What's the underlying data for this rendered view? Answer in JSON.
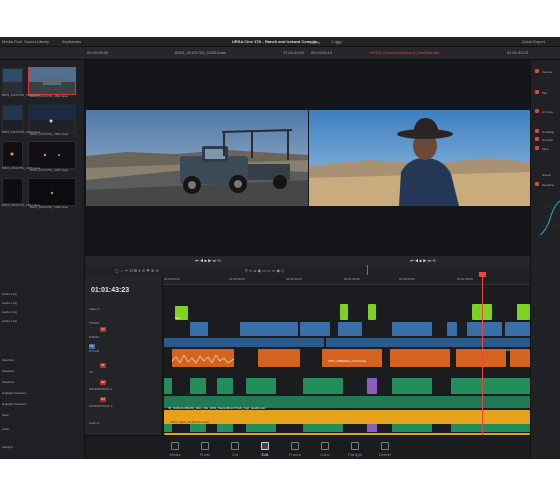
{
  "topbar": {
    "left_items": [
      "Media Pool",
      "Sound Library",
      "Keyframes"
    ],
    "project_title": "URSA Cine 17K - Ranch and Iceland Compile",
    "edited": "Edited",
    "right_items": [
      "Quick Export"
    ]
  },
  "viewer_header": {
    "zoom": "49%",
    "frame": "24",
    "left_timecode": "00:00:08:06",
    "source_clip": "B003_02101725_C002.braw",
    "source_duration": "17:04:44:00",
    "source_tc": "00:04:53:10",
    "timeline_name": "URSA_RanchAndIceland_DuelWander",
    "record_tc": "01:01:43:23"
  },
  "media_pool": {
    "clips": [
      {
        "name": "B003_02101709_C001.braw"
      },
      {
        "name": "B003_02101725_C002.braw"
      },
      {
        "name": "B003_02101736_C003.braw"
      },
      {
        "name": "B003_02101742_C004.braw"
      },
      {
        "name": "B003_02101751_C005.braw"
      },
      {
        "name": "B003_02101760_C006.braw"
      },
      {
        "name": "B003_02101770_C007.braw"
      },
      {
        "name": "B003_02101798_C008.braw"
      }
    ]
  },
  "timeline": {
    "timecode": "01:01:43:23",
    "ruler": [
      "01:00:00:00",
      "01:00:30:00",
      "01:01:00:00",
      "01:01:30:00",
      "01:02:00:00",
      "01:02:30:00"
    ],
    "tracks": [
      {
        "id": "",
        "name": "Video 4"
      },
      {
        "id": "",
        "name": "TITLES"
      },
      {
        "id": "V2",
        "name": "B-ROLL"
      },
      {
        "id": "V1",
        "name": "DYLAN"
      },
      {
        "id": "A1",
        "name": "VO"
      },
      {
        "id": "A2",
        "name": "SOUNDTRACK 1"
      },
      {
        "id": "A3",
        "name": "SOUNDTRACK 2"
      },
      {
        "id": "A4",
        "name": "Audio 4"
      }
    ],
    "title_clip_label": "Text",
    "music_clip_label": "01_SoftlyAndBoldly_Wav_44k_16bit_StereoMusicTrack_high_quality.wav",
    "vo_clip_label": "A001_02092011_C012.braw",
    "dylan_clip_label": "A003_02092011...",
    "a4_clip_label": "A004_Dylan_Reflections.wav"
  },
  "left_timeline_panel": {
    "items": [
      "Audio 1 (A)",
      "Audio 2 (A)",
      "Audio 3 (A)",
      "Audio 4 (A)",
      "Selection",
      "Selection",
      "Selection",
      "Highlight Selection",
      "Highlight Selection",
      "Mark",
      "Audio",
      "Fairlight"
    ]
  },
  "right_panel": {
    "items": [
      "Volume",
      "Pan",
      "AI Voice",
      "AI Dialog",
      "AI Voice",
      "Mute",
      "Speed",
      "Equalizer"
    ]
  },
  "page_tabs": [
    {
      "label": "Media",
      "icon": "media-icon"
    },
    {
      "label": "Photo",
      "icon": "photo-icon"
    },
    {
      "label": "Cut",
      "icon": "cut-icon"
    },
    {
      "label": "Edit",
      "icon": "edit-icon",
      "active": true
    },
    {
      "label": "Fusion",
      "icon": "fusion-icon"
    },
    {
      "label": "Color",
      "icon": "color-icon"
    },
    {
      "label": "Fairlight",
      "icon": "fairlight-icon"
    },
    {
      "label": "Deliver",
      "icon": "deliver-icon"
    }
  ],
  "colors": {
    "accent": "#e44444",
    "video_clip": "#3a6ea6",
    "title_clip": "#7ed321",
    "vo_clip": "#d5621f",
    "soundtrack": "#238e5c",
    "music": "#e5a21a"
  }
}
